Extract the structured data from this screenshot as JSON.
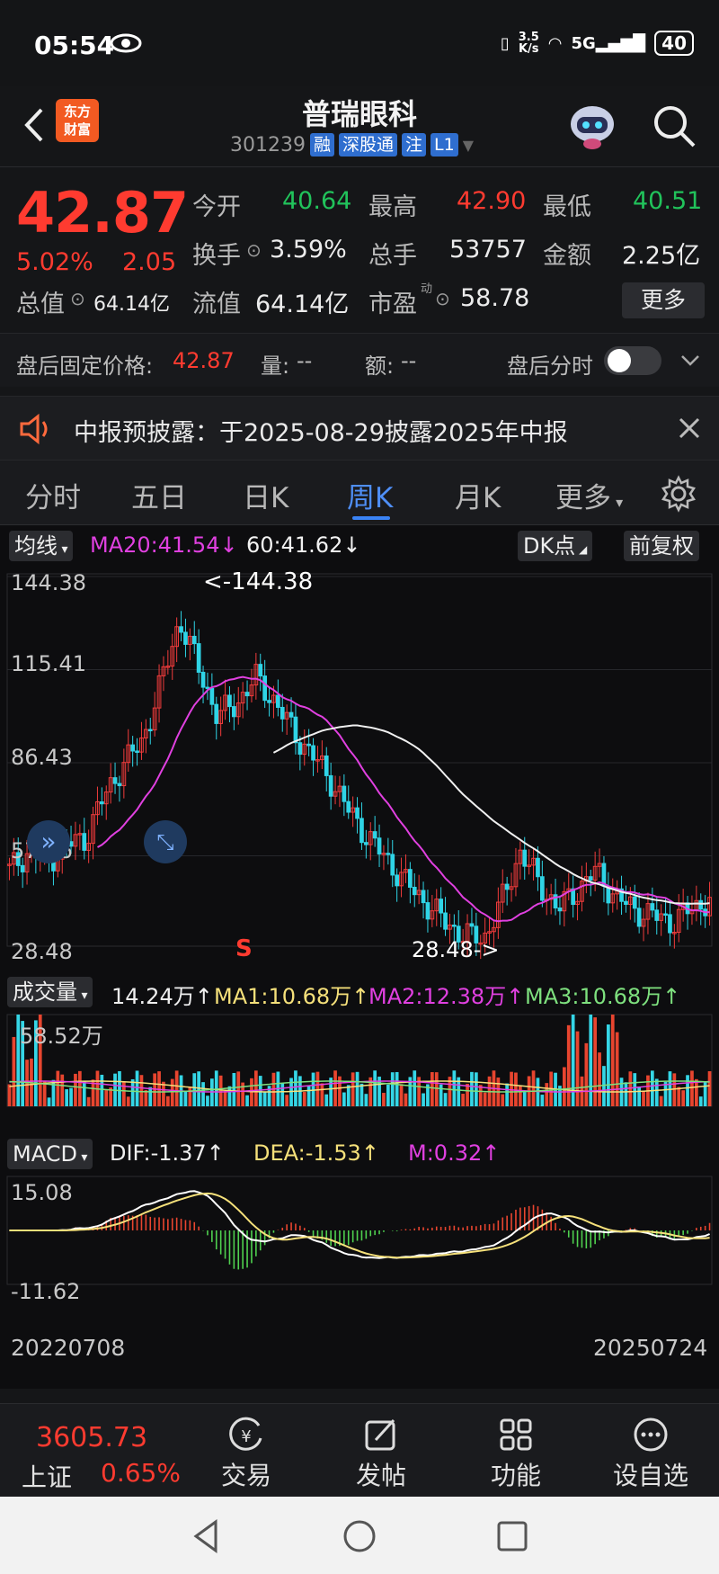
{
  "status": {
    "time": "05:54",
    "net_speed_top": "3.5",
    "net_speed_bottom": "K/s",
    "battery": "40"
  },
  "header": {
    "logo": "东方财富",
    "title": "普瑞眼科",
    "code": "301239",
    "tags": [
      "融",
      "深股通",
      "注",
      "L1"
    ]
  },
  "quote": {
    "price": "42.87",
    "change_pct": "5.02%",
    "change_amt": "2.05",
    "open_label": "今开",
    "open": "40.64",
    "high_label": "最高",
    "high": "42.90",
    "low_label": "最低",
    "low": "40.51",
    "turnover_label": "换手",
    "turnover": "3.59%",
    "volume_label": "总手",
    "volume": "53757",
    "amount_label": "金额",
    "amount": "2.25亿",
    "mktcap_label": "总值",
    "mktcap": "64.14亿",
    "float_label": "流值",
    "float_val": "64.14亿",
    "pe_label": "市盈",
    "pe_sup": "动",
    "pe": "58.78",
    "more": "更多"
  },
  "afterhours": {
    "fixed_label": "盘后固定价格:",
    "fixed": "42.87",
    "vol_label": "量:",
    "vol": "--",
    "amt_label": "额:",
    "amt": "--",
    "timeshare": "盘后分时"
  },
  "notice": {
    "text": "中报预披露：于2025-08-29披露2025年中报"
  },
  "tabs": [
    "分时",
    "五日",
    "日K",
    "周K",
    "月K",
    "更多"
  ],
  "chart": {
    "ma_btn": "均线",
    "ma20": "MA20:41.54↓",
    "ma60": "60:41.62↓",
    "dk_btn": "DK点",
    "adjust_btn": "前复权",
    "y_labels": [
      "144.38",
      "115.41",
      "86.43",
      "57.46",
      "28.48"
    ],
    "high_mark": "<-144.38",
    "low_mark": "28.48->",
    "signal": "S",
    "vol_btn": "成交量",
    "vol_val": "14.24万↑",
    "vol_ma1": "MA1:10.68万↑",
    "vol_ma2": "MA2:12.38万↑",
    "vol_ma3": "MA3:10.68万↑",
    "vol_max": "58.52万",
    "macd_btn": "MACD",
    "dif": "DIF:-1.37↑",
    "dea": "DEA:-1.53↑",
    "m": "M:0.32↑",
    "macd_top": "15.08",
    "macd_bottom": "-11.62",
    "date_start": "20220708",
    "date_end": "20250724"
  },
  "chart_data": {
    "type": "candlestick",
    "period": "weekly",
    "x_range": [
      "20220708",
      "20250724"
    ],
    "ylim": [
      28.48,
      144.38
    ],
    "high": 144.38,
    "low": 28.48,
    "close_trend": [
      52,
      58,
      55,
      60,
      62,
      75,
      85,
      92,
      110,
      130,
      115,
      100,
      104,
      112,
      105,
      95,
      88,
      80,
      70,
      62,
      55,
      48,
      42,
      36,
      32,
      30,
      42,
      58,
      48,
      40,
      46,
      52,
      44,
      40,
      38,
      36,
      40,
      43
    ],
    "ma20": 41.54,
    "ma60": 41.62
  },
  "bottom": {
    "index_val": "3605.73",
    "index_name": "上证",
    "index_chg": "0.65%",
    "items": [
      "交易",
      "发帖",
      "功能",
      "设自选"
    ]
  }
}
